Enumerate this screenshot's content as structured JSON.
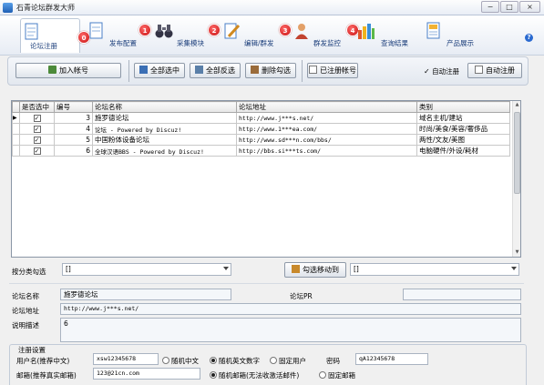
{
  "window": {
    "title": "石青论坛群发大师",
    "min_glyph": "−",
    "max_glyph": "□",
    "close_glyph": "×"
  },
  "tabs": [
    {
      "label": "论坛注册",
      "badge": "0"
    },
    {
      "label": "发布配置",
      "badge": "1"
    },
    {
      "label": "采集模块",
      "badge": "2"
    },
    {
      "label": "编辑/群发",
      "badge": "3"
    },
    {
      "label": "群发监控",
      "badge": "4"
    },
    {
      "label": "查询结果",
      "badge": ""
    },
    {
      "label": "产品展示",
      "badge": ""
    }
  ],
  "help_glyph": "?",
  "actions": {
    "add_account": "加入帐号",
    "select_all": "全部选中",
    "invert_select": "全部反选",
    "delete_checked": "删除勾选",
    "registered_accounts": "已注册帐号",
    "auto_register_check": "自动注册",
    "auto_register_btn": "自动注册"
  },
  "grid": {
    "columns": [
      "是否选中",
      "编号",
      "论坛名称",
      "论坛地址",
      "类别"
    ],
    "rows": [
      {
        "checked": "✓",
        "id": "3",
        "name": "施罗德论坛",
        "url": "http://www.j***s.net/",
        "category": "域名主机/建站"
      },
      {
        "checked": "✓",
        "id": "4",
        "name": "论坛 -  Powered by Discuz!",
        "url": "http://www.1***ea.com/",
        "category": "时尚/美食/美容/奢侈品"
      },
      {
        "checked": "✓",
        "id": "5",
        "name": "中国粉体设备论坛",
        "url": "http://www.sd***n.com/bbs/",
        "category": "两性/文友/美图"
      },
      {
        "checked": "✓",
        "id": "6",
        "name": "全球汉语BBS  - Powered by Discuz!",
        "url": "http://bbs.si***ts.com/",
        "category": "电脑硬件/外设/耗材"
      }
    ],
    "row_marker": "▶"
  },
  "filter": {
    "label": "按分类勾选",
    "value": "[]",
    "move_btn": "勾选移动到",
    "target_value": "[]"
  },
  "detail": {
    "name_label": "论坛名称",
    "name_value": "施罗德论坛",
    "pr_label": "论坛PR",
    "pr_value": "",
    "url_label": "论坛地址",
    "url_value": "http://www.j***s.net/",
    "desc_label": "说明描述",
    "desc_value": "6"
  },
  "register": {
    "group_title": "注册设置",
    "username_label": "用户名(推荐中文)",
    "username_value": "xsw12345678",
    "opt_random_cn": "随机中文",
    "opt_random_en": "随机英文数字",
    "opt_fixed_user": "固定用户",
    "password_label": "密码",
    "password_value": "qA12345678",
    "email_label": "邮箱(推荐真实邮箱)",
    "email_value": "123@21cn.com",
    "opt_random_email": "随机邮箱(无法收激活邮件)",
    "opt_fixed_email": "固定邮箱"
  },
  "colors": {
    "accent": "#1f5fb5",
    "badge": "#d41414",
    "tab_text": "#1a3d7a"
  }
}
